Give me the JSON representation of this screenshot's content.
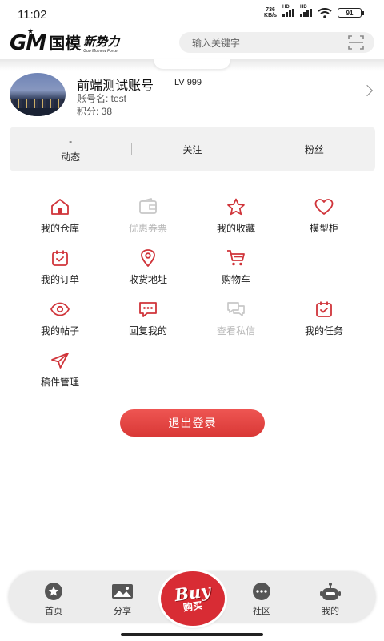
{
  "status_bar": {
    "time": "11:02",
    "net_speed_value": "736",
    "net_speed_unit": "KB/s",
    "signal_tag": "HD",
    "battery": "91"
  },
  "header": {
    "logo_gm": "GM",
    "logo_cn": "国模",
    "logo_slogan": "新势力",
    "logo_slogan_en": "Guo Mo new Force",
    "search_placeholder": "输入关键字"
  },
  "profile": {
    "username": "前端测试账号",
    "level": "LV 999",
    "account_label": "账号名: test",
    "points_label": "积分: 38"
  },
  "stats": [
    {
      "value": "-",
      "label": "动态"
    },
    {
      "value": "",
      "label": "关注"
    },
    {
      "value": "",
      "label": "粉丝"
    }
  ],
  "menu": [
    {
      "label": "我的仓库",
      "icon": "warehouse-icon",
      "enabled": true
    },
    {
      "label": "优惠券票",
      "icon": "coupon-wallet-icon",
      "enabled": false
    },
    {
      "label": "我的收藏",
      "icon": "star-icon",
      "enabled": true
    },
    {
      "label": "模型柜",
      "icon": "heart-icon",
      "enabled": true
    },
    {
      "label": "我的订单",
      "icon": "order-calendar-icon",
      "enabled": true
    },
    {
      "label": "收货地址",
      "icon": "location-pin-icon",
      "enabled": true
    },
    {
      "label": "购物车",
      "icon": "cart-icon",
      "enabled": true
    },
    {
      "label": "我的帖子",
      "icon": "eye-icon",
      "enabled": true
    },
    {
      "label": "回复我的",
      "icon": "chat-bubble-icon",
      "enabled": true
    },
    {
      "label": "查看私信",
      "icon": "messages-icon",
      "enabled": false
    },
    {
      "label": "我的任务",
      "icon": "task-icon",
      "enabled": true
    },
    {
      "label": "稿件管理",
      "icon": "send-icon",
      "enabled": true
    }
  ],
  "logout_label": "退出登录",
  "nav": {
    "home": "首页",
    "share": "分享",
    "buy_en": "Buy",
    "buy_cn": "购买",
    "community": "社区",
    "mine": "我的"
  },
  "colors": {
    "accent": "#d93836",
    "icon_red": "#d0343a",
    "disabled": "#c8c8c8",
    "nav_icon": "#555555"
  }
}
